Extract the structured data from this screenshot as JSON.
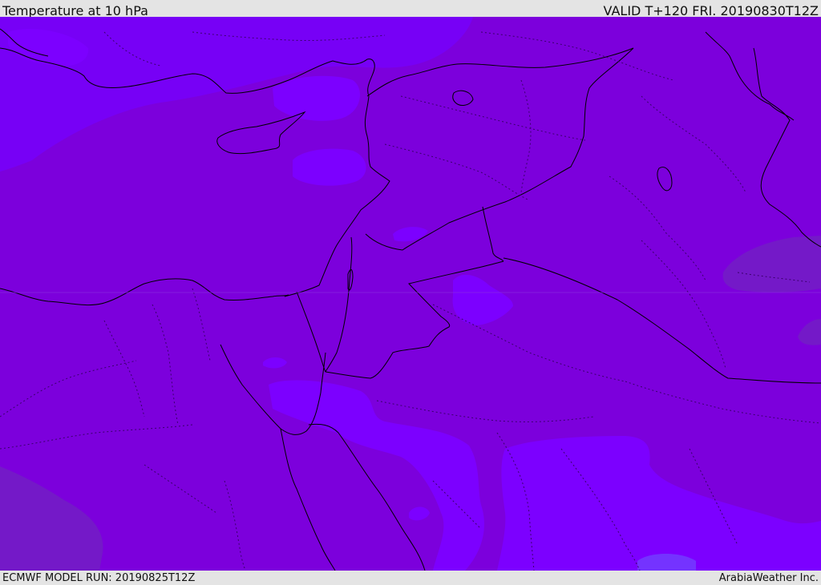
{
  "header": {
    "title": "Temperature at 10 hPa",
    "valid": "VALID T+120 FRI. 20190830T12Z"
  },
  "footer": {
    "model_run": "ECMWF MODEL RUN: 20190825T12Z",
    "credit": "ArabiaWeather Inc."
  },
  "colors": {
    "base_fill": "#7c00dc",
    "warm_band_fill": "#7a05e6",
    "cold_band_fill": "#7c00ff",
    "coldest_fill": "#7433ff",
    "warm_patch_fill": "#7419c8",
    "border_line": "#000000"
  }
}
